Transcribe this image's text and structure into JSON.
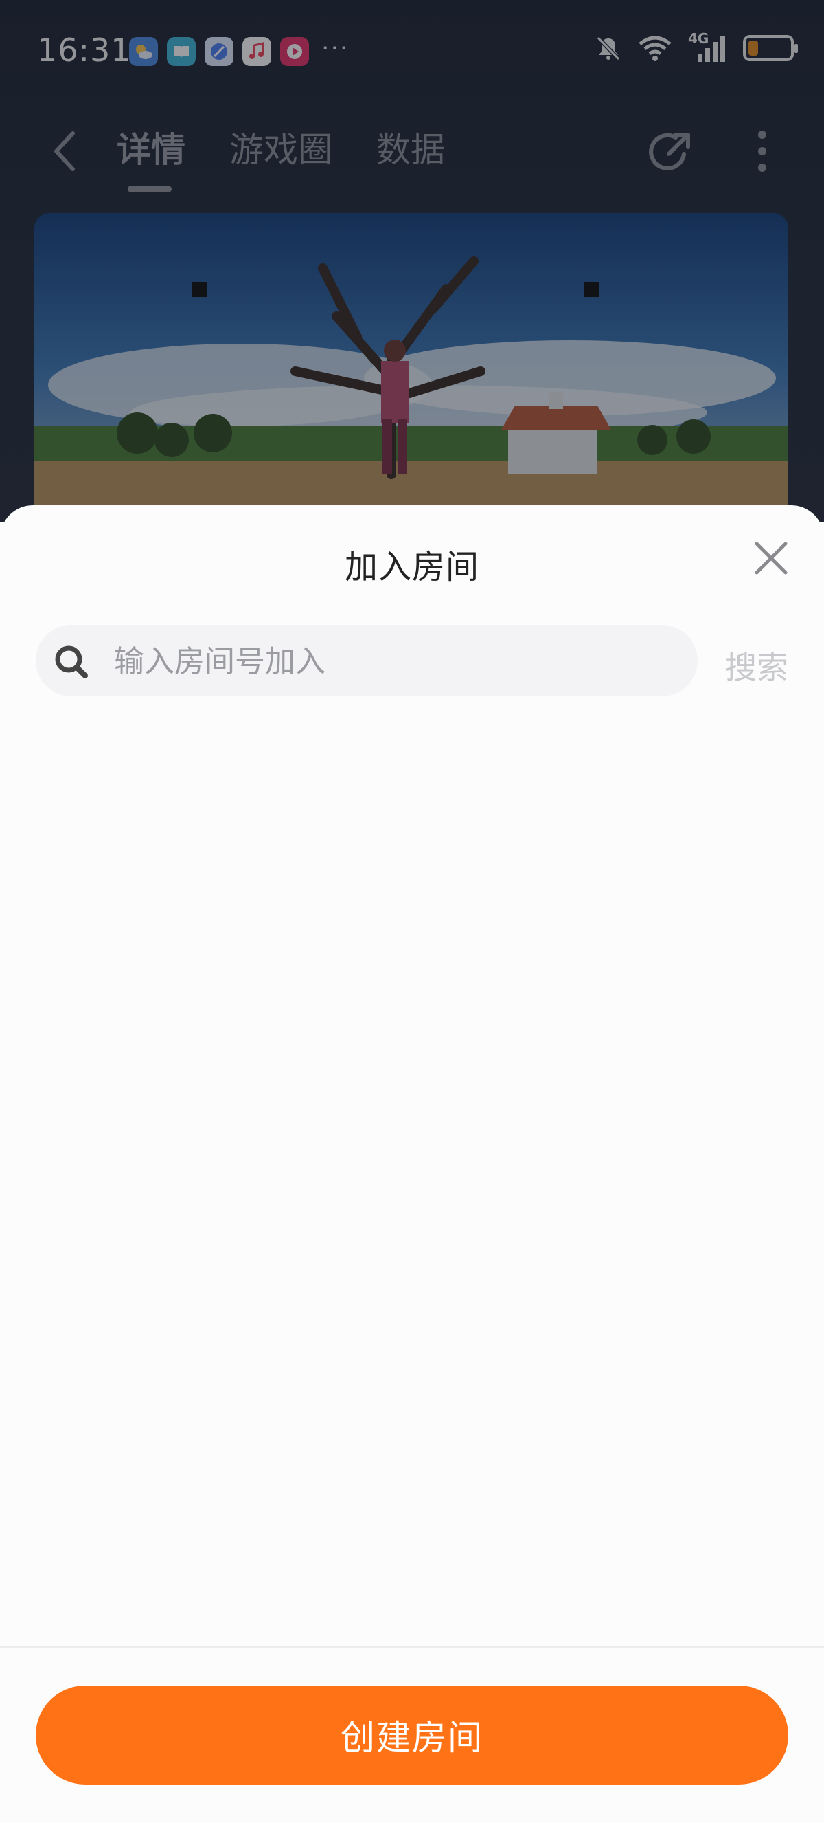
{
  "status_bar": {
    "time": "16:31",
    "app_icons": [
      "weather-icon",
      "book-icon",
      "browser-icon",
      "music-icon",
      "video-icon"
    ],
    "more": "···",
    "network": "4G"
  },
  "nav": {
    "tabs": [
      {
        "label": "详情",
        "active": true
      },
      {
        "label": "游戏圈",
        "active": false
      },
      {
        "label": "数据",
        "active": false
      }
    ]
  },
  "sheet": {
    "title": "加入房间",
    "search": {
      "placeholder": "输入房间号加入",
      "value": "",
      "button_label": "搜索"
    },
    "create_button_label": "创建房间"
  },
  "colors": {
    "accent": "#ff7216",
    "dim_background": "#232c3a",
    "battery_level": "#e08a1f"
  }
}
